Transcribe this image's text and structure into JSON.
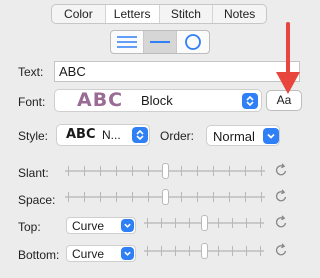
{
  "tabs": [
    {
      "label": "Color",
      "active": false
    },
    {
      "label": "Letters",
      "active": true
    },
    {
      "label": "Stitch",
      "active": false
    },
    {
      "label": "Notes",
      "active": false
    }
  ],
  "layout_options": [
    {
      "icon": "horizontal-lines-icon",
      "active": false
    },
    {
      "icon": "single-line-icon",
      "active": true
    },
    {
      "icon": "circle-icon",
      "active": false
    }
  ],
  "text": {
    "label": "Text:",
    "value": "ABC"
  },
  "font": {
    "label": "Font:",
    "preview": "ABC",
    "name": "Block",
    "button_label": "Aa"
  },
  "style": {
    "label": "Style:",
    "preview": "ABC",
    "name": "N..."
  },
  "order": {
    "label": "Order:",
    "value": "Normal"
  },
  "sliders": {
    "slant": {
      "label": "Slant:",
      "level": 0.5
    },
    "space": {
      "label": "Space:",
      "level": 0.5
    },
    "top": {
      "label": "Top:",
      "mode": "Curve",
      "level": 0.5
    },
    "bottom": {
      "label": "Bottom:",
      "mode": "Curve",
      "level": 0.5
    }
  },
  "colors": {
    "accent": "#2f7ff6",
    "font_preview": "#9a6b95",
    "annotation_arrow": "#e8453c"
  }
}
